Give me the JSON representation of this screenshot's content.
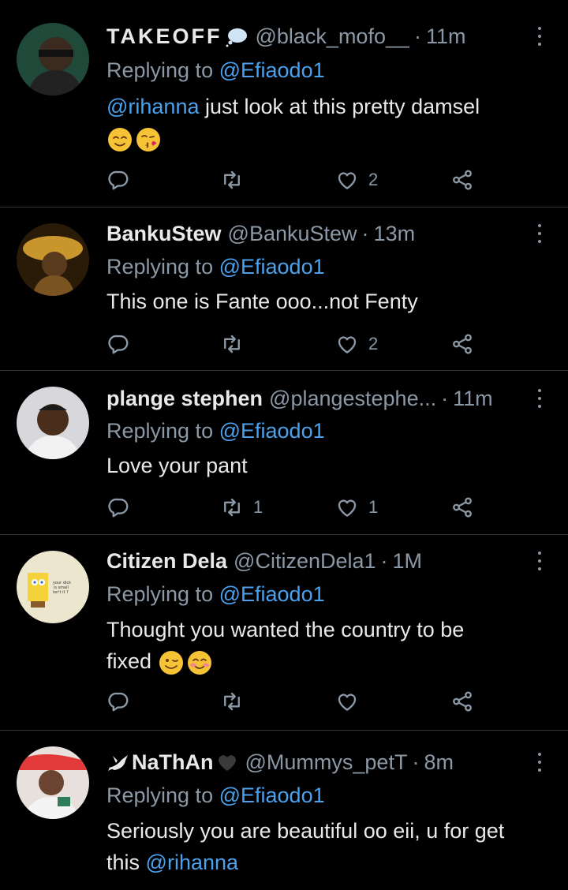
{
  "tweets": [
    {
      "display_name": "TAKEOFF",
      "name_badge": "speech-bubble",
      "handle": "@black_mofo__",
      "separator": "·",
      "time": "11m",
      "replying_prefix": "Replying to",
      "replying_to": "@Efiaodo1",
      "mention": "@rihanna",
      "text": "just look at this pretty damsel",
      "emojis": [
        "relieved-face",
        "kissing-face"
      ],
      "reply_count": "",
      "retweet_count": "",
      "like_count": "2"
    },
    {
      "display_name": "BankuStew",
      "handle": "@BankuStew",
      "separator": "·",
      "time": "13m",
      "replying_prefix": "Replying to",
      "replying_to": "@Efiaodo1",
      "text": "This one is Fante ooo...not Fenty",
      "reply_count": "",
      "retweet_count": "",
      "like_count": "2"
    },
    {
      "display_name": "plange stephen",
      "handle": "@plangestephe...",
      "separator": "·",
      "time": "11m",
      "replying_prefix": "Replying to",
      "replying_to": "@Efiaodo1",
      "text": "Love your pant",
      "reply_count": "",
      "retweet_count": "1",
      "like_count": "1"
    },
    {
      "display_name": "Citizen Dela",
      "handle": "@CitizenDela1",
      "separator": "·",
      "time": "1M",
      "replying_prefix": "Replying to",
      "replying_to": "@Efiaodo1",
      "text_line1": "Thought you wanted the country to be",
      "text_line2": "fixed",
      "emojis": [
        "winking-face",
        "smiling-blush-face"
      ],
      "avatar_caption": [
        "your dick",
        "is small",
        "isn't it ?"
      ],
      "reply_count": "",
      "retweet_count": "",
      "like_count": ""
    },
    {
      "display_name_prefix_icon": "dove",
      "display_name": "NaThAn",
      "name_suffix_icon": "black-heart",
      "handle": "@Mummys_petT",
      "separator": "·",
      "time": "8m",
      "replying_prefix": "Replying to",
      "replying_to": "@Efiaodo1",
      "text_line1": "Seriously you are beautiful oo eii, u for get",
      "text_line2": "this",
      "mention": "@rihanna",
      "reply_count": "",
      "retweet_count": "",
      "like_count": ""
    }
  ],
  "colors": {
    "background": "#000000",
    "text": "#e7e9ea",
    "secondary": "#8b98a5",
    "link": "#4aa2ef",
    "divider": "#2f3336"
  }
}
